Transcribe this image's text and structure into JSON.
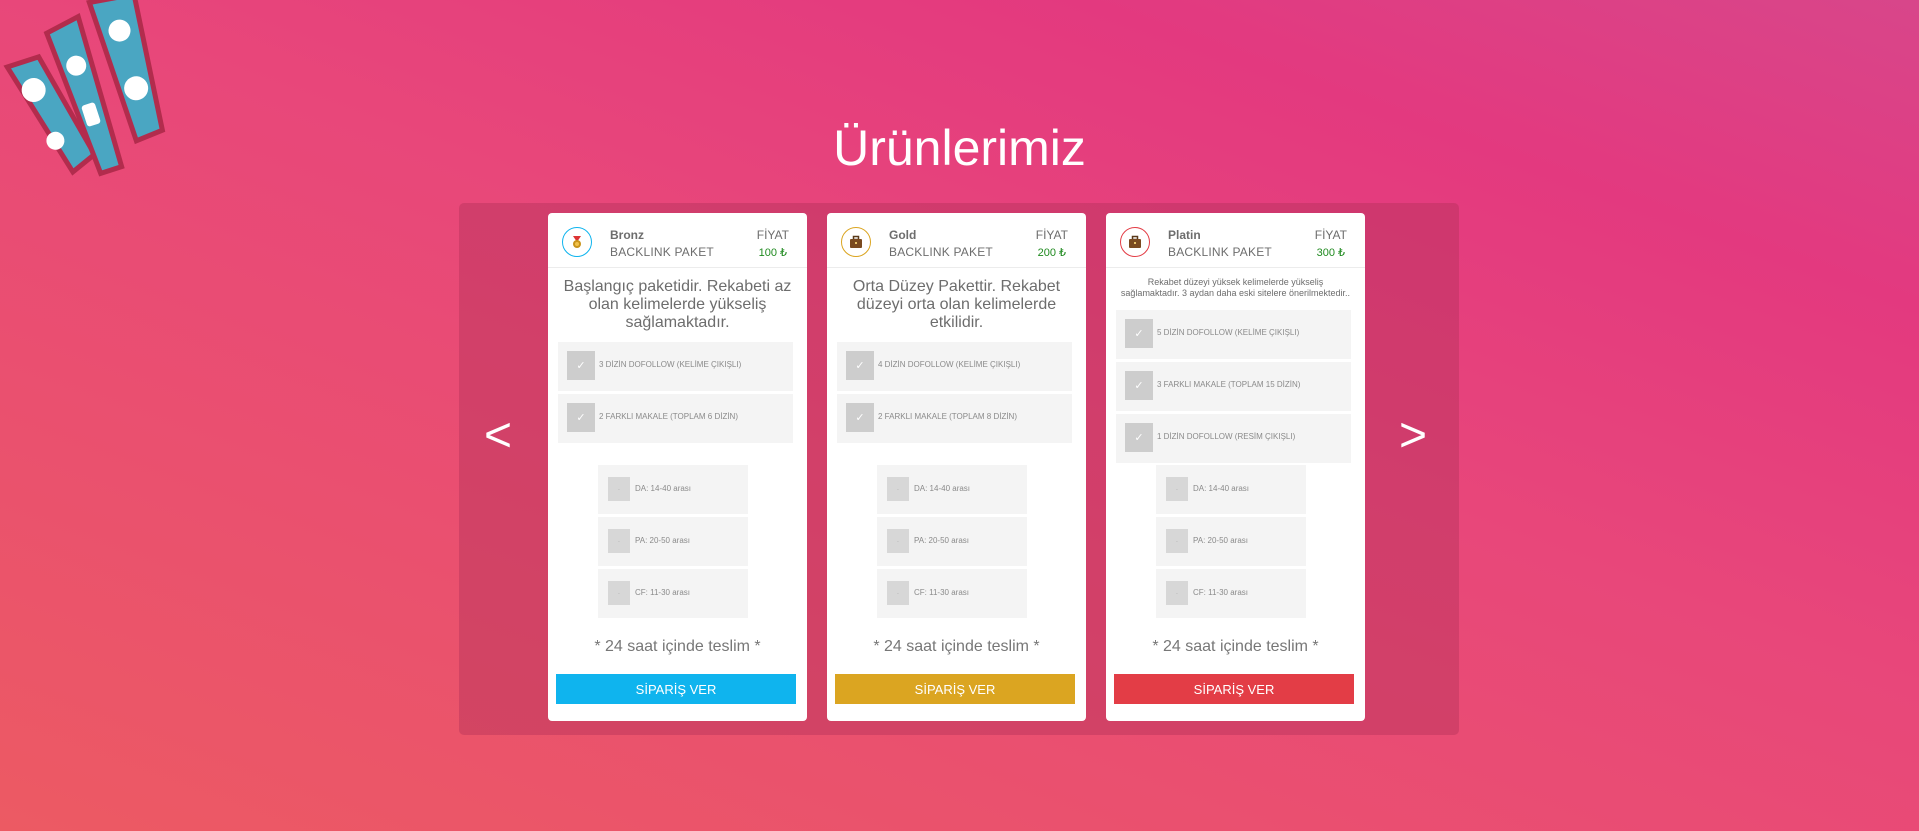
{
  "page": {
    "title": "Ürünlerimiz",
    "prev_arrow": "<",
    "next_arrow": ">"
  },
  "logo": {
    "icon": "social-media-logo"
  },
  "colors": {
    "background_start": "#ec5a63",
    "background_end": "#e3397f",
    "bronz_accent": "#0fb4ee",
    "gold_accent": "#dba521",
    "platin_accent": "#e33d46",
    "price_green": "#1f8a1f"
  },
  "cards": [
    {
      "name": "Bronz",
      "subtitle": "BACKLINK PAKET",
      "price_label": "FİYAT",
      "price": "100 ₺",
      "icon": "medal-icon",
      "description": "Başlangıç paketidir. Rekabeti az olan kelimelerde yükseliş sağlamaktadır.",
      "features": [
        {
          "check": "✓",
          "text": "3 DİZİN DOFOLLOW (KELİME ÇIKIŞLI)"
        },
        {
          "check": "✓",
          "text": "2 FARKLI MAKALE (TOPLAM 6 DİZİN)"
        }
      ],
      "metrics": [
        {
          "mark": "·",
          "text": "DA: 14-40 arası"
        },
        {
          "mark": "·",
          "text": "PA: 20-50 arası"
        },
        {
          "mark": "·",
          "text": "CF: 11-30 arası"
        }
      ],
      "delivery": "* 24 saat içinde teslim *",
      "button": "SİPARİŞ VER"
    },
    {
      "name": "Gold",
      "subtitle": "BACKLINK PAKET",
      "price_label": "FİYAT",
      "price": "200 ₺",
      "icon": "briefcase-icon",
      "description": "Orta Düzey Pakettir. Rekabet düzeyi orta olan kelimelerde etkilidir.",
      "features": [
        {
          "check": "✓",
          "text": "4 DİZİN DOFOLLOW (KELİME ÇIKIŞLI)"
        },
        {
          "check": "✓",
          "text": "2 FARKLI MAKALE (TOPLAM 8 DİZİN)"
        }
      ],
      "metrics": [
        {
          "mark": "·",
          "text": "DA: 14-40 arası"
        },
        {
          "mark": "·",
          "text": "PA: 20-50 arası"
        },
        {
          "mark": "·",
          "text": "CF: 11-30 arası"
        }
      ],
      "delivery": "* 24 saat içinde teslim *",
      "button": "SİPARİŞ VER"
    },
    {
      "name": "Platin",
      "subtitle": "BACKLINK PAKET",
      "price_label": "FİYAT",
      "price": "300 ₺",
      "icon": "briefcase-icon",
      "description": "Rekabet düzeyi yüksek kelimelerde yükseliş sağlamaktadır. 3 aydan daha eski sitelere önerilmektedir..",
      "features": [
        {
          "check": "✓",
          "text": "5 DİZİN DOFOLLOW (KELİME ÇIKIŞLI)"
        },
        {
          "check": "✓",
          "text": "3 FARKLI MAKALE (TOPLAM 15 DİZİN)"
        },
        {
          "check": "✓",
          "text": "1 DİZİN DOFOLLOW (RESİM ÇIKIŞLI)"
        }
      ],
      "metrics": [
        {
          "mark": "·",
          "text": "DA: 14-40 arası"
        },
        {
          "mark": "·",
          "text": "PA: 20-50 arası"
        },
        {
          "mark": "·",
          "text": "CF: 11-30 arası"
        }
      ],
      "delivery": "* 24 saat içinde teslim *",
      "button": "SİPARİŞ VER"
    }
  ]
}
